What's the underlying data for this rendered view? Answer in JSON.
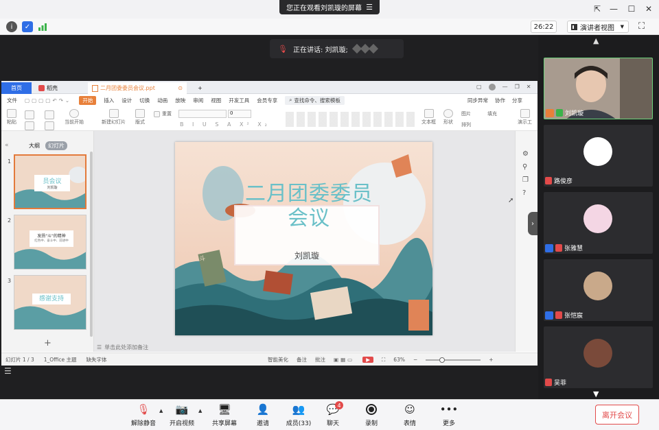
{
  "window": {
    "share_banner": "您正在观看刘凯璇的屏幕"
  },
  "infobar": {
    "timer": "26:22",
    "view_mode": "演讲者视图"
  },
  "speaker": {
    "prefix": "正在讲话: 刘凯璇;"
  },
  "wps": {
    "tabs": [
      {
        "label": "首页"
      },
      {
        "label": "稻壳"
      },
      {
        "label": "二月团委委员会议.ppt"
      }
    ],
    "right_tabs": {
      "sync": "同步异常",
      "collab": "协作",
      "share": "分享"
    },
    "menu": [
      "文件",
      "开始",
      "插入",
      "设计",
      "切换",
      "动画",
      "放映",
      "审阅",
      "视图",
      "开发工具",
      "会员专享"
    ],
    "search": "查找命令、搜索模板",
    "ribbon": {
      "paste": "粘贴",
      "from_current": "当前开始",
      "new_slide": "新建幻灯片",
      "layout": "版式",
      "reset": "重置",
      "font_size": "0",
      "textbox": "文本框",
      "shape": "形状",
      "arrange": "排列",
      "image": "图片",
      "fill": "填充",
      "show": "演示工"
    },
    "panel_tabs": {
      "outline": "大纲",
      "slides": "幻灯片"
    },
    "slide_numbers": [
      "1",
      "2",
      "3"
    ],
    "thumbs": [
      {
        "title": "员会议",
        "sub": "刘凯璇"
      },
      {
        "title": "发扬\"斗\"的精神",
        "sub": "红色中、奋斗中、前进中"
      },
      {
        "title": "感谢支持",
        "sub": ""
      }
    ],
    "slide": {
      "title": "二月团委委员会议",
      "subtitle": "刘凯璇",
      "book_label": "斗"
    },
    "notes": "单击此处添加备注",
    "status": {
      "slide_count": "幻灯片 1 / 3",
      "theme": "1_Office 主题",
      "missing_font": "缺失字体",
      "beautify": "智能美化",
      "notes_btn": "备注",
      "comment": "批注",
      "zoom": "63%"
    }
  },
  "participants": [
    {
      "name": "刘凯璇",
      "host": true,
      "muted": false
    },
    {
      "name": "路俊彦",
      "host": false,
      "muted": true
    },
    {
      "name": "张雅慧",
      "host": true,
      "muted": true
    },
    {
      "name": "张恺宸",
      "host": true,
      "muted": true
    },
    {
      "name": "吴菲",
      "host": false,
      "muted": true
    }
  ],
  "toolbar": {
    "mute": "解除静音",
    "video": "开启视频",
    "share": "共享屏幕",
    "invite": "邀请",
    "members": "成员(33)",
    "chat": "聊天",
    "chat_badge": "4",
    "record": "录制",
    "reactions": "表情",
    "more": "更多",
    "leave": "离开会议"
  },
  "colors": {
    "accent": "#2f6ee6",
    "leave": "#e24a4a",
    "wps_start": "#e8803a",
    "slide_title": "#6ac0c8"
  }
}
